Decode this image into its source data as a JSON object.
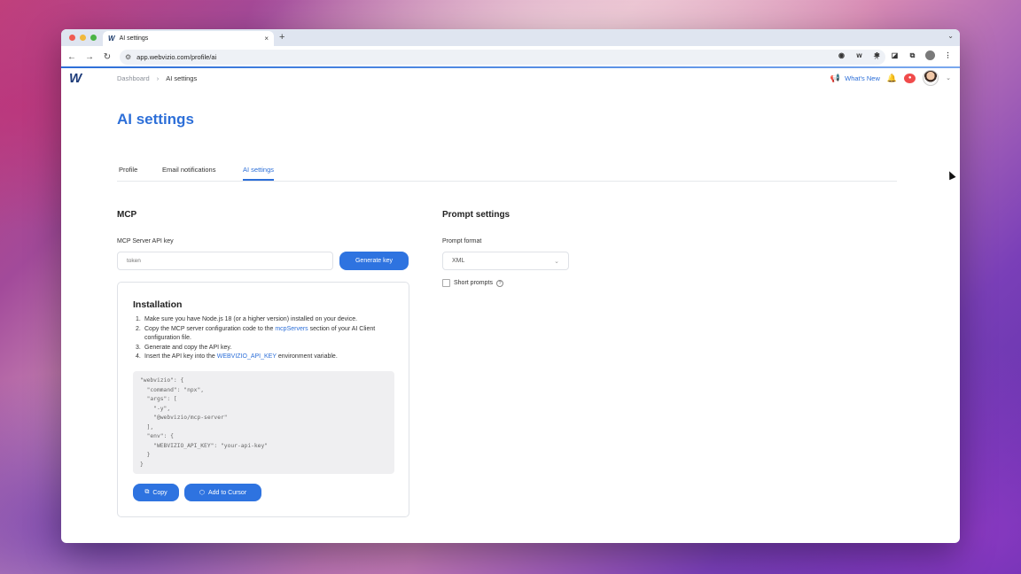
{
  "browser": {
    "tab_title": "AI settings",
    "tab_favicon": "W",
    "new_tab": "+",
    "tab_close": "×",
    "url": "app.webvizio.com/profile/ai"
  },
  "app": {
    "logo": "W",
    "breadcrumb": [
      "Dashboard",
      "›",
      "AI settings"
    ],
    "whats_new": "What's New"
  },
  "page": {
    "title": "AI settings",
    "tabs": [
      "Profile",
      "Email notifications",
      "AI settings"
    ],
    "active_tab": "AI settings"
  },
  "mcp": {
    "title": "MCP",
    "api_key_label": "MCP Server API key",
    "api_key_placeholder": "token",
    "generate_button": "Generate key",
    "installation": {
      "title": "Installation",
      "steps": [
        {
          "num": "1.",
          "pre": "Make sure you have Node.js 18 (or a higher version) installed on your device.",
          "link": "",
          "post": ""
        },
        {
          "num": "2.",
          "pre": "Copy the MCP server configuration code to the ",
          "link": "mcpServers",
          "post": " section of your AI Client configuration file."
        },
        {
          "num": "3.",
          "pre": "Generate and copy the API key.",
          "link": "",
          "post": ""
        },
        {
          "num": "4.",
          "pre": "Insert the API key into the ",
          "link": "WEBVIZIO_API_KEY",
          "post": " environment variable."
        }
      ],
      "code": "\"webvizio\": {\n  \"command\": \"npx\",\n  \"args\": [\n    \"-y\",\n    \"@webvizio/mcp-server\"\n  ],\n  \"env\": {\n    \"WEBVIZIO_API_KEY\": \"your-api-key\"\n  }\n}",
      "copy_button": "Copy",
      "cursor_button": "Add to Cursor"
    }
  },
  "prompt": {
    "title": "Prompt settings",
    "format_label": "Prompt format",
    "format_value": "XML",
    "short_prompts_label": "Short prompts",
    "short_prompts_checked": false
  },
  "colors": {
    "accent": "#2e73e0"
  }
}
